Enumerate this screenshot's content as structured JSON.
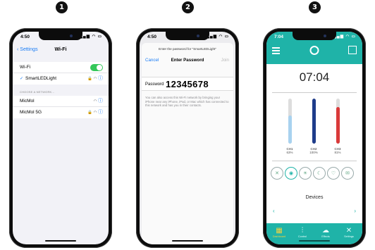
{
  "steps": [
    "1",
    "2",
    "3"
  ],
  "phone1": {
    "time": "4:50",
    "status_icons": "▂▄▆ ◠ ▭",
    "back_label": "Settings",
    "title": "Wi-Fi",
    "wifi_label": "Wi-Fi",
    "wifi_enabled": true,
    "connected_network": "SmartLEDLight",
    "connected_icons": "🔒 ◠",
    "section_header": "CHOOSE A NETWORK...",
    "networks": [
      {
        "name": "MicMol",
        "icons": "◠"
      },
      {
        "name": "MicMol 5G",
        "icons": "🔒 ◠"
      }
    ],
    "info_icon": "ⓘ"
  },
  "phone2": {
    "time": "4:50",
    "status_icons": "▂▄▆ ◠ ▭",
    "prompt": "Enter the password for \"SmartLEDLight\"",
    "cancel_label": "Cancel",
    "title": "Enter Password",
    "join_label": "Join",
    "password_label": "Password",
    "password_value": "12345678",
    "help_text": "You can also access this Wi-Fi network by bringing your iPhone near any iPhone, iPad, or Mac which has connected to this network and has you in their contacts."
  },
  "phone3": {
    "time": "7:04",
    "status_icons": "▂▄▆ ◠ ▭",
    "clock": "07:04",
    "channels": [
      {
        "name": "CH1",
        "percent": "63%",
        "level": 0.63,
        "color": "#a8d2ef"
      },
      {
        "name": "CH2",
        "percent": "100%",
        "level": 1.0,
        "color": "#1f3c8a"
      },
      {
        "name": "CH3",
        "percent": "81%",
        "level": 0.81,
        "color": "#d93a3a"
      }
    ],
    "modes": [
      "✕",
      "◉",
      "☀",
      "☾",
      "♡",
      "✉"
    ],
    "devices_label": "Devices",
    "arrow_left": "‹",
    "arrow_right": "›",
    "tabs": [
      {
        "icon": "▦",
        "label": "Dashboard"
      },
      {
        "icon": "⫶",
        "label": "Control"
      },
      {
        "icon": "☁",
        "label": "Effects"
      },
      {
        "icon": "✕",
        "label": "Settings"
      }
    ],
    "accent_color": "#1fb3a8"
  }
}
